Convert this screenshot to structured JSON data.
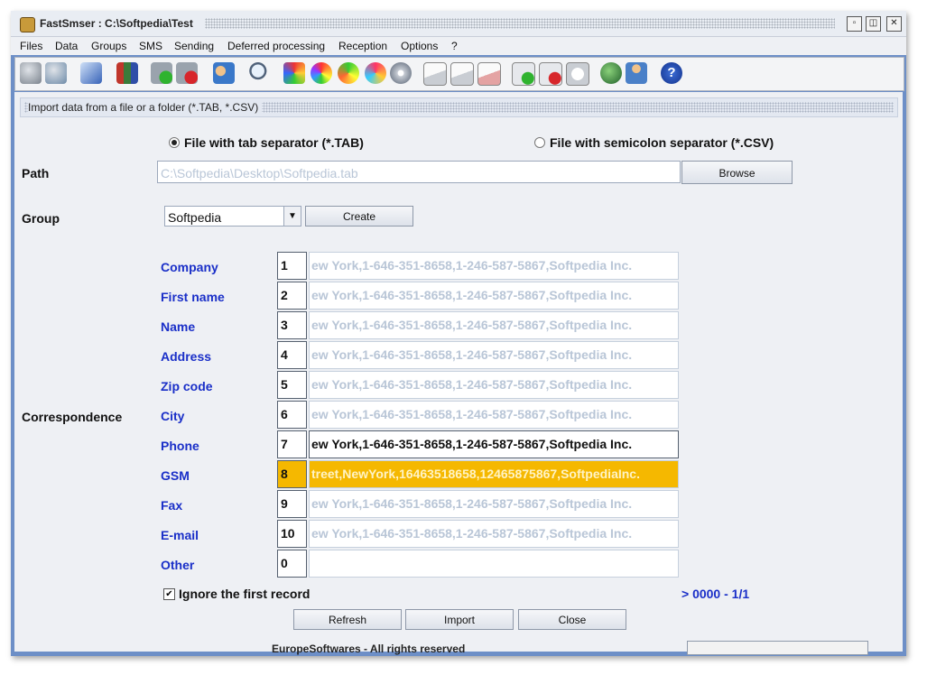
{
  "window": {
    "title": "FastSmser : C:\\Softpedia\\Test",
    "buttons": {
      "minimize": "▫",
      "maximize": "◫",
      "close": "✕"
    }
  },
  "menu": [
    "Files",
    "Data",
    "Groups",
    "SMS",
    "Sending",
    "Deferred processing",
    "Reception",
    "Options",
    "?"
  ],
  "toolbar_icons": [
    "database-icon",
    "database-export-icon",
    "back-arrow-icon",
    "books-icon",
    "database-add-icon",
    "database-remove-icon",
    "users-icon",
    "search-icon",
    "paint-icon",
    "color-wheel-icon",
    "refresh-color-icon",
    "palette-icon",
    "color-cd-icon",
    "mail-new-icon",
    "mail-open-icon",
    "mail-remove-icon",
    "gauge-add-icon",
    "gauge-remove-icon",
    "gauge-icon",
    "globe-icon",
    "person-icon",
    "help-icon"
  ],
  "section": {
    "title": "Import data from a file or a folder (*.TAB, *.CSV)"
  },
  "format": {
    "tab_label": "File with tab separator (*.TAB)",
    "csv_label": "File with semicolon separator (*.CSV)",
    "selected": "tab"
  },
  "path": {
    "label": "Path",
    "value": "C:\\Softpedia\\Desktop\\Softpedia.tab",
    "browse": "Browse"
  },
  "group": {
    "label": "Group",
    "value": "Softpedia",
    "create": "Create"
  },
  "correspondence": {
    "label": "Correspondence",
    "rows": [
      {
        "name": "Company",
        "index": "1",
        "sample": "ew York,1-646-351-8658,1-246-587-5867,Softpedia Inc.",
        "state": "normal"
      },
      {
        "name": "First name",
        "index": "2",
        "sample": "ew York,1-646-351-8658,1-246-587-5867,Softpedia Inc.",
        "state": "normal"
      },
      {
        "name": "Name",
        "index": "3",
        "sample": "ew York,1-646-351-8658,1-246-587-5867,Softpedia Inc.",
        "state": "normal"
      },
      {
        "name": "Address",
        "index": "4",
        "sample": "ew York,1-646-351-8658,1-246-587-5867,Softpedia Inc.",
        "state": "normal"
      },
      {
        "name": "Zip code",
        "index": "5",
        "sample": "ew York,1-646-351-8658,1-246-587-5867,Softpedia Inc.",
        "state": "normal"
      },
      {
        "name": "City",
        "index": "6",
        "sample": "ew York,1-646-351-8658,1-246-587-5867,Softpedia Inc.",
        "state": "normal"
      },
      {
        "name": "Phone",
        "index": "7",
        "sample": "ew York,1-646-351-8658,1-246-587-5867,Softpedia Inc.",
        "state": "focused"
      },
      {
        "name": "GSM",
        "index": "8",
        "sample": "treet,NewYork,16463518658,12465875867,SoftpediaInc.",
        "state": "selected"
      },
      {
        "name": "Fax",
        "index": "9",
        "sample": "ew York,1-646-351-8658,1-246-587-5867,Softpedia Inc.",
        "state": "normal"
      },
      {
        "name": "E-mail",
        "index": "10",
        "sample": "ew York,1-646-351-8658,1-246-587-5867,Softpedia Inc.",
        "state": "normal"
      },
      {
        "name": "Other",
        "index": "0",
        "sample": "",
        "state": "normal"
      }
    ]
  },
  "ignore_first": {
    "label": "Ignore the first record",
    "checked": true
  },
  "record_counter": "> 0000 - 1/1",
  "actions": {
    "refresh": "Refresh",
    "import": "Import",
    "close": "Close"
  },
  "footer": "EuropeSoftwares - All rights reserved",
  "colors": {
    "selected_row": "#f5b800",
    "label_blue": "#1a2fc8",
    "frame": "#6d8fc7"
  }
}
